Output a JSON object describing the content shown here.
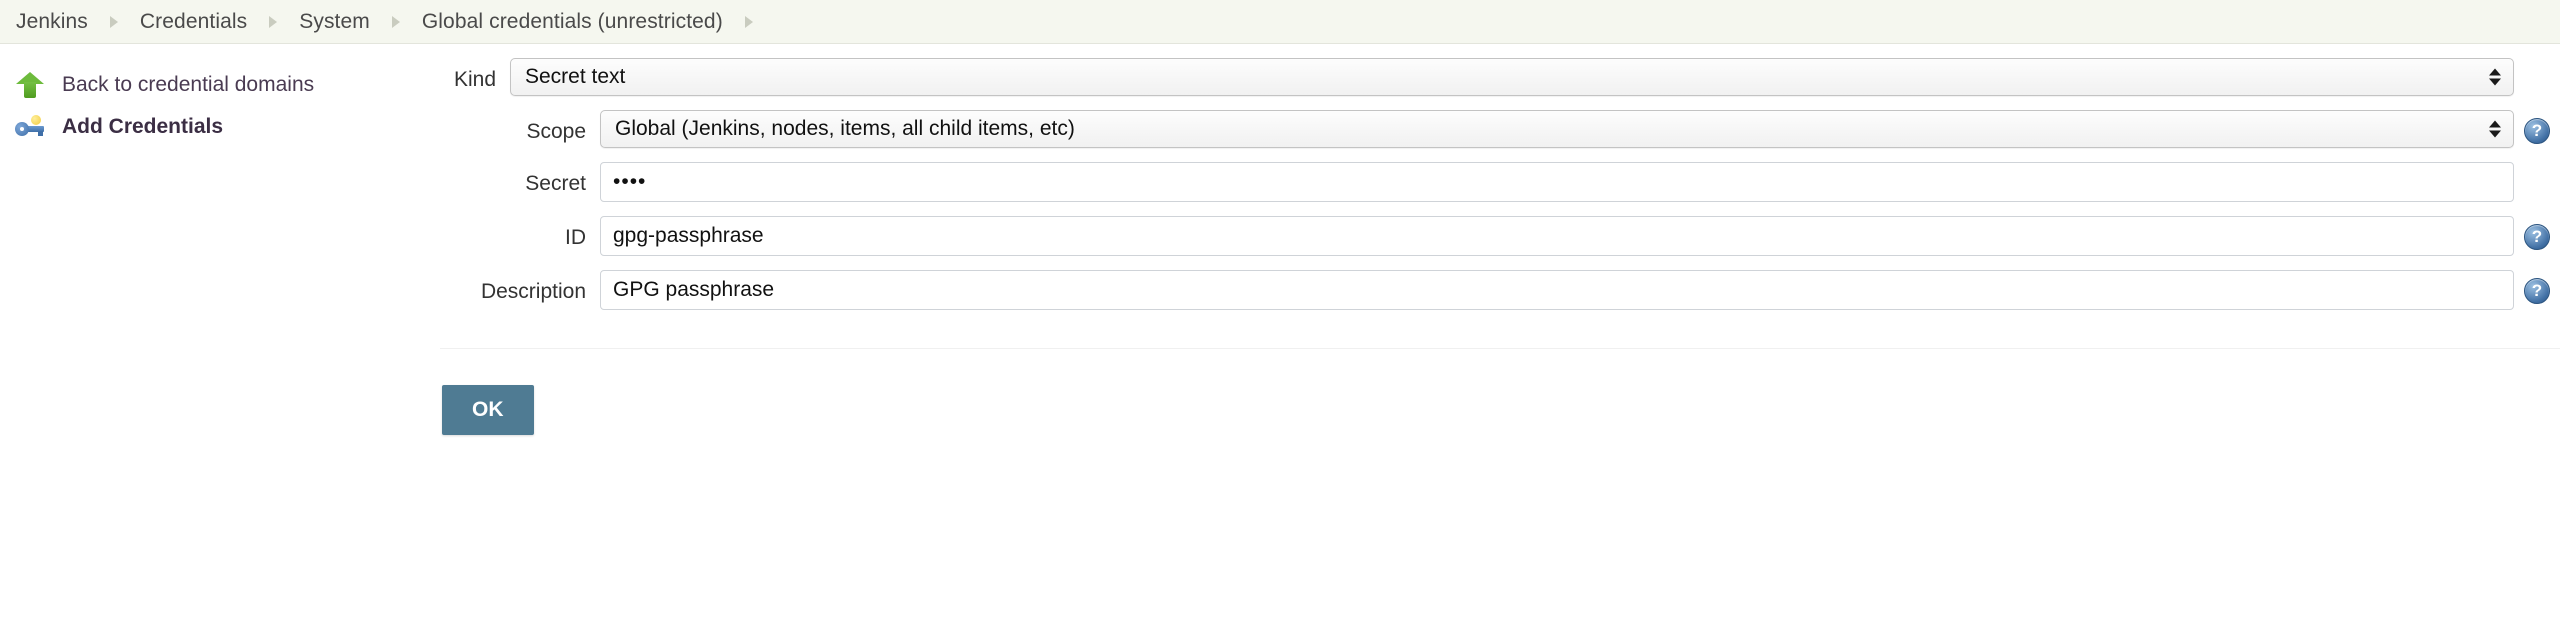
{
  "breadcrumb": {
    "items": [
      {
        "label": "Jenkins"
      },
      {
        "label": "Credentials"
      },
      {
        "label": "System"
      },
      {
        "label": "Global credentials (unrestricted)"
      }
    ]
  },
  "sidebar": {
    "tasks": [
      {
        "label": "Back to credential domains",
        "icon": "up-arrow-icon",
        "bold": false
      },
      {
        "label": "Add Credentials",
        "icon": "key-icon",
        "bold": true
      }
    ]
  },
  "form": {
    "kind": {
      "label": "Kind",
      "value": "Secret text",
      "options": [
        "Secret text"
      ]
    },
    "scope": {
      "label": "Scope",
      "value": "Global (Jenkins, nodes, items, all child items, etc)",
      "options": [
        "Global (Jenkins, nodes, items, all child items, etc)"
      ],
      "help": "?"
    },
    "secret": {
      "label": "Secret",
      "value": "••••",
      "placeholder": ""
    },
    "id": {
      "label": "ID",
      "value": "gpg-passphrase",
      "placeholder": "",
      "help": "?"
    },
    "description": {
      "label": "Description",
      "value": "GPG passphrase",
      "placeholder": "",
      "help": "?"
    },
    "submit": {
      "label": "OK"
    }
  },
  "colors": {
    "breadcrumb_background": "#f5f7ef",
    "ok_button": "#4f7b93",
    "help_icon": "#3f6ea3",
    "up_arrow_icon": "#6dbb3c",
    "key_icon": "#3f6fa8"
  }
}
